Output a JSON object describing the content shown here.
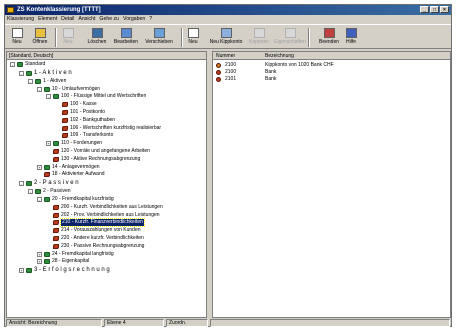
{
  "window": {
    "title": "ZS Kontenklassierung [TTTT]",
    "controls": [
      "_",
      "□",
      "×"
    ]
  },
  "menu": [
    "Klassierung",
    "Element",
    "Detail",
    "Ansicht",
    "Gehe zu",
    "Vorgaben",
    "?"
  ],
  "toolbar": [
    {
      "label": "Neu",
      "icon": "new-doc-icon",
      "enabled": true
    },
    {
      "label": "Öffnen",
      "icon": "open-folder-icon",
      "enabled": true
    },
    {
      "label": "Neu",
      "icon": "new-element-icon",
      "enabled": false
    },
    {
      "label": "Löschen",
      "icon": "delete-icon",
      "enabled": true
    },
    {
      "label": "Bearbeiten",
      "icon": "edit-icon",
      "enabled": true
    },
    {
      "label": "Verschieben",
      "icon": "move-icon",
      "enabled": true
    },
    {
      "label": "Neu",
      "icon": "new-detail-icon",
      "enabled": true
    },
    {
      "label": "Neu Kippkonto",
      "icon": "new-kippkonto-icon",
      "enabled": true
    },
    {
      "label": "Kopieren",
      "icon": "copy-icon",
      "enabled": false
    },
    {
      "label": "Eigenschaften",
      "icon": "properties-icon",
      "enabled": false
    },
    {
      "label": "Beenden",
      "icon": "exit-icon",
      "enabled": true
    },
    {
      "label": "Hilfe",
      "icon": "help-icon",
      "enabled": true
    }
  ],
  "left_header": "[Standard, Deutsch]",
  "tree": [
    {
      "label": "Standard",
      "level": 0,
      "expander": "−",
      "icon": "green",
      "big": false
    },
    {
      "label": "1 - A k t i v e n",
      "level": 1,
      "expander": "−",
      "icon": "green",
      "big": true
    },
    {
      "label": "1 - Aktiven",
      "level": 2,
      "expander": "−",
      "icon": "green",
      "big": false
    },
    {
      "label": "10 - Umlaufvermögen",
      "level": 3,
      "expander": "−",
      "icon": "green",
      "big": false
    },
    {
      "label": "100 - Flüssige Mittel und Wertschriften",
      "level": 4,
      "expander": "−",
      "icon": "green",
      "big": false
    },
    {
      "label": "100 - Kasse",
      "level": 5,
      "expander": "",
      "icon": "red",
      "big": false
    },
    {
      "label": "101 - Postkonto",
      "level": 5,
      "expander": "",
      "icon": "red",
      "big": false
    },
    {
      "label": "102 - Bankguthaben",
      "level": 5,
      "expander": "",
      "icon": "red",
      "big": false
    },
    {
      "label": "106 - Wertschriften kurzfristig realisierbar",
      "level": 5,
      "expander": "",
      "icon": "red",
      "big": false
    },
    {
      "label": "109 - Transferkonto",
      "level": 5,
      "expander": "",
      "icon": "red",
      "big": false
    },
    {
      "label": "110 - Forderungen",
      "level": 4,
      "expander": "+",
      "icon": "green",
      "big": false
    },
    {
      "label": "120 - Vorräte und angefangene Arbeiten",
      "level": 4,
      "expander": "",
      "icon": "red",
      "big": false
    },
    {
      "label": "130 - Aktive Rechnungsabgrenzung",
      "level": 4,
      "expander": "",
      "icon": "red",
      "big": false
    },
    {
      "label": "14 - Anlagevermögen",
      "level": 3,
      "expander": "+",
      "icon": "green",
      "big": false
    },
    {
      "label": "18 - Aktivierter Aufwand",
      "level": 3,
      "expander": "",
      "icon": "red",
      "big": false
    },
    {
      "label": "2 - P a s s i v e n",
      "level": 1,
      "expander": "−",
      "icon": "green",
      "big": true
    },
    {
      "label": "2 - Passiven",
      "level": 2,
      "expander": "−",
      "icon": "green",
      "big": false
    },
    {
      "label": "20 - Fremdkapital kurzfristig",
      "level": 3,
      "expander": "−",
      "icon": "green",
      "big": false
    },
    {
      "label": "200 - Kurzfr. Verbindlichkeiten aus Leistungen",
      "level": 4,
      "expander": "",
      "icon": "red",
      "big": false
    },
    {
      "label": "202 - Prov. Verbindlichkeiten aus Leistungen",
      "level": 4,
      "expander": "",
      "icon": "red",
      "big": false
    },
    {
      "label": "210 - Kurzfr. Finanzverbindlichkeiten",
      "level": 4,
      "expander": "",
      "icon": "red",
      "big": false,
      "selected": true
    },
    {
      "label": "214 - Vorauszahlungen von Kunden",
      "level": 4,
      "expander": "",
      "icon": "red",
      "big": false
    },
    {
      "label": "220 - Andere kurzfr. Verbindlichkeiten",
      "level": 4,
      "expander": "",
      "icon": "red",
      "big": false
    },
    {
      "label": "230 - Passive Rechnungsabgrenzung",
      "level": 4,
      "expander": "",
      "icon": "red",
      "big": false
    },
    {
      "label": "24 - Fremdkapital langfristig",
      "level": 3,
      "expander": "+",
      "icon": "green",
      "big": false
    },
    {
      "label": "28 - Eigenkapital",
      "level": 3,
      "expander": "+",
      "icon": "green",
      "big": false
    },
    {
      "label": "3 - E r f o l g s r e c h n u n g",
      "level": 1,
      "expander": "+",
      "icon": "green",
      "big": true
    }
  ],
  "detail": {
    "columns": [
      "Nummer",
      "Bezeichnung"
    ],
    "rows": [
      {
        "number": "2100",
        "name": "Kippkonto von 1020 Bank CHF",
        "icon": "kippkonto"
      },
      {
        "number": "2100",
        "name": "Bank",
        "icon": "account"
      },
      {
        "number": "2101",
        "name": "Bank",
        "icon": "account"
      }
    ]
  },
  "statusbar": [
    "Ansicht: Bezeichnung",
    "Ebene 4",
    "Zuordn."
  ],
  "colors": {
    "title_start": "#0a246a",
    "title_end": "#3a6ea5",
    "node_green": "#2e8b3e",
    "node_red": "#b93b1f",
    "face": "#d4d0c8"
  }
}
